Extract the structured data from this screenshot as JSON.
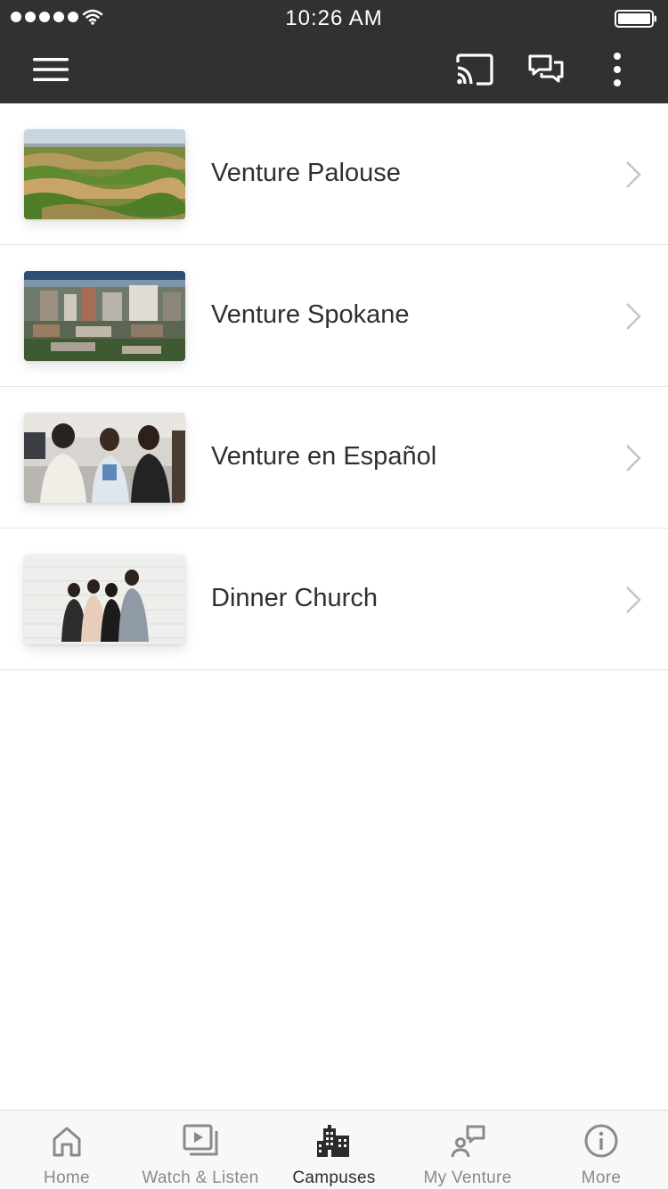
{
  "status_bar": {
    "time": "10:26 AM"
  },
  "app_bar": {
    "icons": [
      "hamburger-menu-icon",
      "cast-icon",
      "chat-icon",
      "more-vertical-icon"
    ]
  },
  "campuses": [
    {
      "label": "Venture Palouse",
      "thumbnail": "palouse-hills-photo"
    },
    {
      "label": "Venture Spokane",
      "thumbnail": "spokane-skyline-photo"
    },
    {
      "label": "Venture en Español",
      "thumbnail": "people-talking-photo"
    },
    {
      "label": "Dinner Church",
      "thumbnail": "family-group-photo"
    }
  ],
  "tabs": [
    {
      "label": "Home",
      "icon": "home-icon",
      "active": false
    },
    {
      "label": "Watch & Listen",
      "icon": "video-playlist-icon",
      "active": false
    },
    {
      "label": "Campuses",
      "icon": "buildings-icon",
      "active": true
    },
    {
      "label": "My Venture",
      "icon": "person-message-icon",
      "active": false
    },
    {
      "label": "More",
      "icon": "info-icon",
      "active": false
    }
  ],
  "colors": {
    "app_bar": "#313131",
    "active_tab": "#2b2b2b",
    "inactive_tab": "#8a8a8a"
  }
}
